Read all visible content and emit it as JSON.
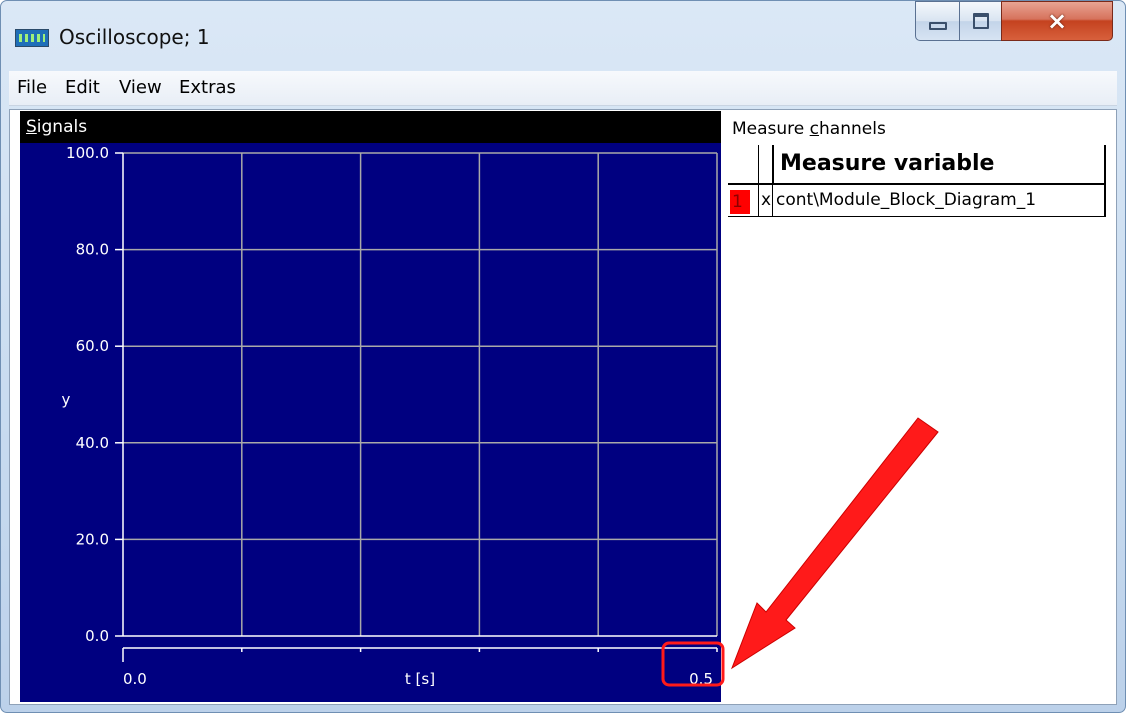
{
  "window": {
    "title": "Oscilloscope; 1",
    "icon": "oscilloscope-app-icon",
    "controls": {
      "minimize": "minimize-icon",
      "maximize": "maximize-icon",
      "close": "×"
    }
  },
  "menu": {
    "items": [
      "File",
      "Edit",
      "View",
      "Extras"
    ]
  },
  "signals": {
    "title_underlined": "S",
    "title_rest": "ignals",
    "background_color": "#000080",
    "grid_color": "#a9a9a9"
  },
  "channels": {
    "title_pre": "Measure ",
    "title_underlined": "c",
    "title_post": "hannels",
    "header": "Measure variable",
    "rows": [
      {
        "number": "1",
        "flag": "x",
        "variable": "cont\\Module_Block_Diagram_1",
        "color": "#ff0000"
      }
    ]
  },
  "chart_data": {
    "type": "line",
    "title": "",
    "xlabel": "t [s]",
    "ylabel": "y",
    "xlim": [
      0.0,
      0.5
    ],
    "ylim": [
      0.0,
      100.0
    ],
    "x_tick_labels": [
      "0.0",
      "0.5"
    ],
    "y_tick_labels": [
      "100.0",
      "80.0",
      "60.0",
      "40.0",
      "20.0",
      "0.0"
    ],
    "y_ticks": [
      100.0,
      80.0,
      60.0,
      40.0,
      20.0,
      0.0
    ],
    "x_grid_divisions": 5,
    "grid": true,
    "series": []
  },
  "annotation": {
    "color": "#ff1a1a"
  }
}
